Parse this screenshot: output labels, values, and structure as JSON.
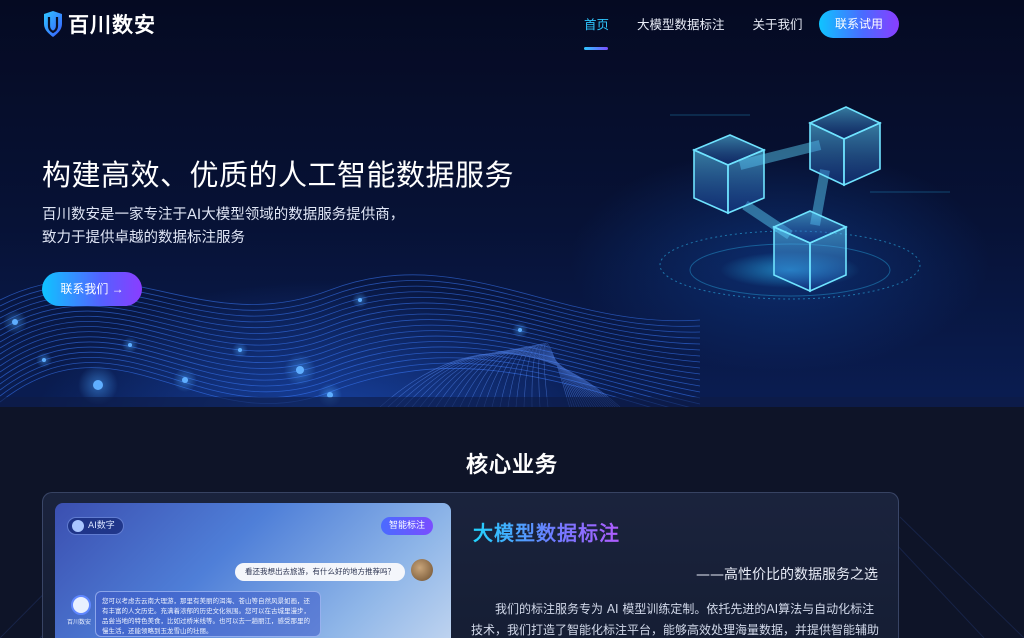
{
  "brand": {
    "name": "百川数安"
  },
  "nav": {
    "items": [
      {
        "label": "首页",
        "active": true
      },
      {
        "label": "大模型数据标注",
        "active": false
      },
      {
        "label": "关于我们",
        "active": false
      }
    ],
    "cta_label": "联系试用"
  },
  "hero": {
    "title": "构建高效、优质的人工智能数据服务",
    "subtitle_line1": "百川数安是一家专注于AI大模型领域的数据服务提供商，",
    "subtitle_line2": "致力于提供卓越的数据标注服务",
    "button_label": "联系我们 →"
  },
  "section": {
    "title": "核心业务",
    "card": {
      "title": "大模型数据标注",
      "slogan": "——高性价比的数据服务之选",
      "description": "我们的标注服务专为 AI 模型训练定制。依托先进的AI算法与自动化标注技术，我们打造了智能化标注平台，能够高效处理海量数据，并提供智能辅助标注",
      "preview": {
        "chip_label": "AI数字",
        "tag_label": "智能标注",
        "user_message": "看还我想出去旅游，有什么好的地方推荐吗？",
        "ai_label": "百川数安",
        "ai_message": "您可以考虑去云南大理游，那里有美丽的洱海、苍山等自然风景如画，还有丰富的人文历史。充满着浓郁的历史文化氛围。您可以在古城里漫步，品尝当地的特色美食，比如过桥米线等。也可以去一趟丽江，感受那里的慢生活，还能领略到玉龙雪山的壮丽。"
      }
    }
  },
  "colors": {
    "accent_cyan": "#2fc7ff",
    "accent_purple": "#8a3dff",
    "background": "#0a1026"
  }
}
